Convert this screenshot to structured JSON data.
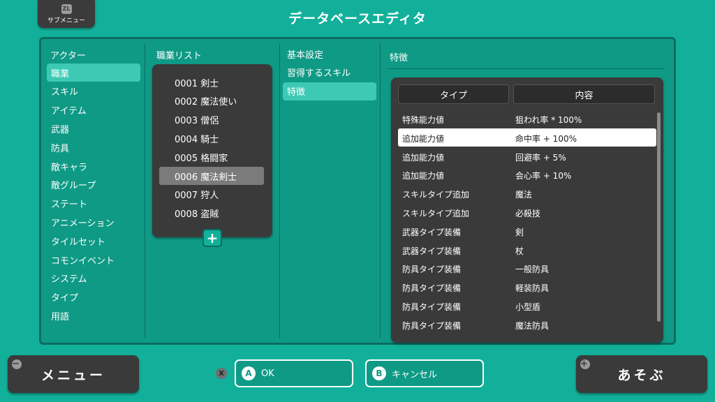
{
  "window": {
    "title": "データベースエディタ"
  },
  "submenu": {
    "badge": "ZL",
    "label": "サブメニュー"
  },
  "categories": {
    "header": "アクター",
    "items": [
      "職業",
      "スキル",
      "アイテム",
      "武器",
      "防具",
      "敵キャラ",
      "敵グループ",
      "ステート",
      "アニメーション",
      "タイルセット",
      "コモンイベント",
      "システム",
      "タイプ",
      "用語"
    ],
    "selected_index": 0
  },
  "job_list": {
    "header": "職業リスト",
    "items": [
      "0001 剣士",
      "0002 魔法使い",
      "0003 僧侶",
      "0004 騎士",
      "0005 格闘家",
      "0006 魔法剣士",
      "0007 狩人",
      "0008 盗賊"
    ],
    "selected_index": 5,
    "add_symbol": "+"
  },
  "sections": {
    "items": [
      "基本設定",
      "習得するスキル",
      "特徴"
    ],
    "selected_index": 2
  },
  "traits": {
    "header": "特徴",
    "col_type": "タイプ",
    "col_content": "内容",
    "rows": [
      {
        "type": "特殊能力値",
        "content": "狙われ率 * 100%"
      },
      {
        "type": "追加能力値",
        "content": "命中率 + 100%"
      },
      {
        "type": "追加能力値",
        "content": "回避率 + 5%"
      },
      {
        "type": "追加能力値",
        "content": "会心率 + 10%"
      },
      {
        "type": "スキルタイプ追加",
        "content": "魔法"
      },
      {
        "type": "スキルタイプ追加",
        "content": "必殺技"
      },
      {
        "type": "武器タイプ装備",
        "content": "剣"
      },
      {
        "type": "武器タイプ装備",
        "content": "杖"
      },
      {
        "type": "防具タイプ装備",
        "content": "一般防具"
      },
      {
        "type": "防具タイプ装備",
        "content": "軽装防具"
      },
      {
        "type": "防具タイプ装備",
        "content": "小型盾"
      },
      {
        "type": "防具タイプ装備",
        "content": "魔法防具"
      }
    ],
    "selected_index": 1
  },
  "bottom": {
    "menu_label": "メニュー",
    "menu_glyph": "−",
    "play_label": "あそぶ",
    "play_glyph": "+",
    "x_glyph": "X",
    "ok_glyph": "A",
    "ok_label": "OK",
    "cancel_glyph": "B",
    "cancel_label": "キャンセル"
  },
  "colors": {
    "background": "#12b09a",
    "panel": "#0f9a86",
    "selection": "#3ec9b4",
    "dark_box": "#3a3a3a"
  }
}
